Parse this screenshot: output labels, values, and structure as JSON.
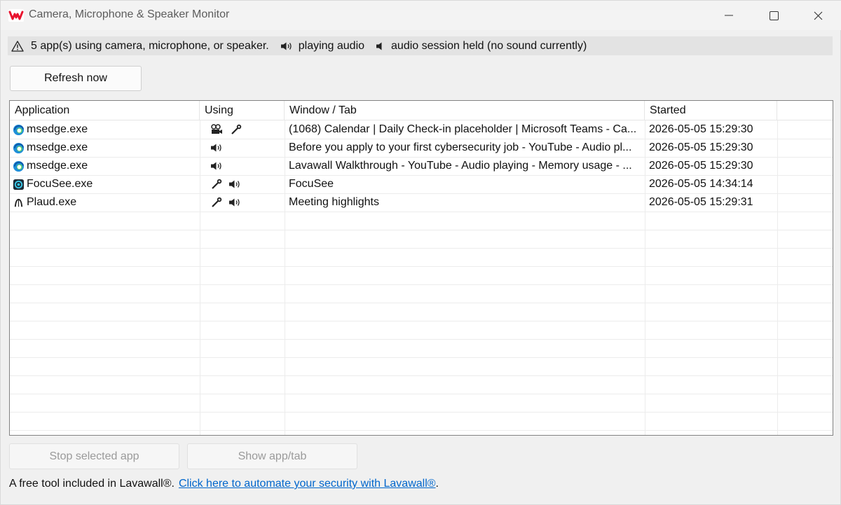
{
  "window": {
    "title": "Camera, Microphone & Speaker Monitor",
    "logo_icon": "lavawall-logo-icon",
    "accent_color": "#e8112d"
  },
  "status": {
    "summary": "5 app(s) using camera, microphone, or speaker.",
    "legend_playing": "playing audio",
    "legend_held": "audio session held (no sound currently)"
  },
  "toolbar": {
    "refresh_label": "Refresh now"
  },
  "table": {
    "columns": [
      "Application",
      "Using",
      "Window / Tab",
      "Started"
    ],
    "rows": [
      {
        "app": "msedge.exe",
        "app_icon": "edge-icon",
        "using": [
          "camera-icon",
          "microphone-icon"
        ],
        "window": "(1068) Calendar | Daily Check-in placeholder | Microsoft Teams - Ca...",
        "started": "2026-05-05 15:29:30"
      },
      {
        "app": "msedge.exe",
        "app_icon": "edge-icon",
        "using": [
          "speaker-playing-icon"
        ],
        "window": "Before you apply to your first cybersecurity job - YouTube - Audio pl...",
        "started": "2026-05-05 15:29:30"
      },
      {
        "app": "msedge.exe",
        "app_icon": "edge-icon",
        "using": [
          "speaker-playing-icon"
        ],
        "window": "Lavawall Walkthrough - YouTube - Audio playing - Memory usage - ...",
        "started": "2026-05-05 15:29:30"
      },
      {
        "app": "FocuSee.exe",
        "app_icon": "focusee-icon",
        "using": [
          "microphone-icon",
          "speaker-playing-icon"
        ],
        "window": "FocuSee",
        "started": "2026-05-05 14:34:14"
      },
      {
        "app": "Plaud.exe",
        "app_icon": "plaud-icon",
        "using": [
          "microphone-icon",
          "speaker-playing-icon"
        ],
        "window": "Meeting highlights",
        "started": "2026-05-05 15:29:31"
      }
    ]
  },
  "actions": {
    "stop_label": "Stop selected app",
    "show_label": "Show app/tab"
  },
  "footer": {
    "text": "A free tool included in Lavawall®.",
    "link": "Click here to automate your security with Lavawall®",
    "link_suffix": "."
  }
}
